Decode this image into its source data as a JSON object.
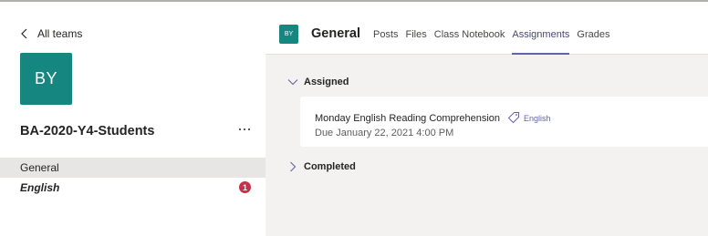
{
  "nav": {
    "back_label": "All teams"
  },
  "team": {
    "initials": "BY",
    "name": "BA-2020-Y4-Students"
  },
  "channels": [
    {
      "label": "General",
      "selected": true
    },
    {
      "label": "English",
      "badge": "1"
    }
  ],
  "header": {
    "channel_initials": "BY",
    "channel_name": "General",
    "tabs": [
      "Posts",
      "Files",
      "Class Notebook",
      "Assignments",
      "Grades"
    ],
    "active_tab": "Assignments"
  },
  "sections": {
    "assigned_label": "Assigned",
    "completed_label": "Completed"
  },
  "assignments": [
    {
      "title": "Monday English Reading Comprehension",
      "tag": "English",
      "due": "Due January 22, 2021 4:00 PM"
    }
  ],
  "colors": {
    "team_accent": "#158680",
    "brand_purple": "#6264a7",
    "badge_red": "#c4314b"
  }
}
